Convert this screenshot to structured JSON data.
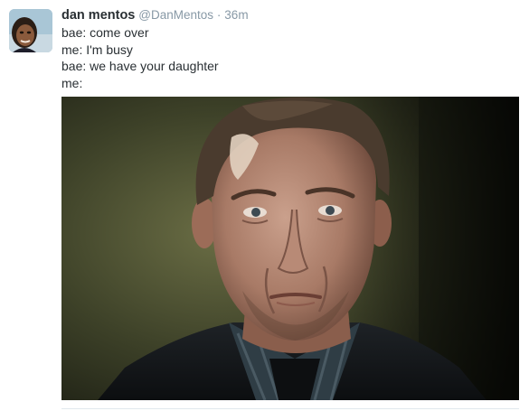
{
  "tweet": {
    "author": {
      "fullname": "dan mentos",
      "username": "@DanMentos",
      "avatar_icon": "profile-avatar"
    },
    "separator": "·",
    "timestamp": "36m",
    "text_lines": [
      "bae: come over",
      "me: I'm busy",
      "bae: we have your daughter",
      "me:"
    ],
    "media": {
      "icon": "photo-man-worried-expression"
    }
  },
  "colors": {
    "name": "#292f33",
    "secondary": "#8899a6",
    "divider": "#e1e8ed"
  }
}
